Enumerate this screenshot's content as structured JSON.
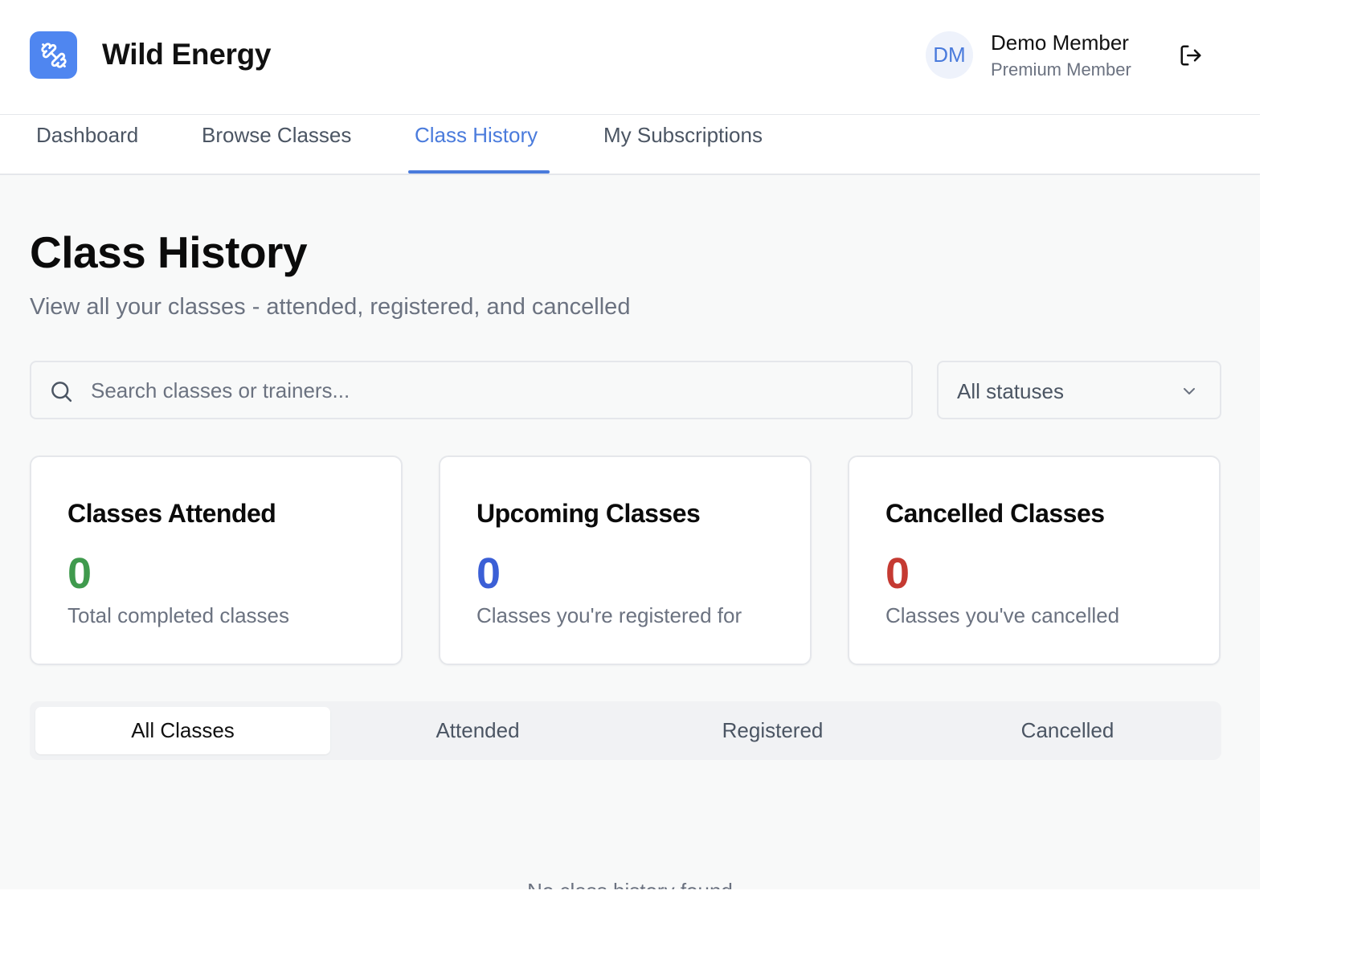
{
  "app": {
    "brand": "Wild Energy",
    "logo_icon": "dumbbell-icon"
  },
  "user": {
    "initials": "DM",
    "name": "Demo Member",
    "role": "Premium Member",
    "logout_icon": "logout-icon"
  },
  "nav": {
    "items": [
      {
        "label": "Dashboard"
      },
      {
        "label": "Browse Classes"
      },
      {
        "label": "Class History",
        "active": true
      },
      {
        "label": "My Subscriptions"
      }
    ]
  },
  "page": {
    "title": "Class History",
    "subtitle": "View all your classes - attended, registered, and cancelled"
  },
  "filters": {
    "search_placeholder": "Search classes or trainers...",
    "search_value": "",
    "status_selected": "All statuses"
  },
  "stats": [
    {
      "title": "Classes Attended",
      "value": "0",
      "description": "Total completed classes",
      "color": "#3f9a4d"
    },
    {
      "title": "Upcoming Classes",
      "value": "0",
      "description": "Classes you're registered for",
      "color": "#3b5fd6"
    },
    {
      "title": "Cancelled Classes",
      "value": "0",
      "description": "Classes you've cancelled",
      "color": "#c53a32"
    }
  ],
  "tabs": [
    {
      "label": "All Classes",
      "active": true
    },
    {
      "label": "Attended"
    },
    {
      "label": "Registered"
    },
    {
      "label": "Cancelled"
    }
  ],
  "empty_state": "No class history found",
  "colors": {
    "accent": "#4a7bdc",
    "logo_bg": "#4f86f0"
  }
}
